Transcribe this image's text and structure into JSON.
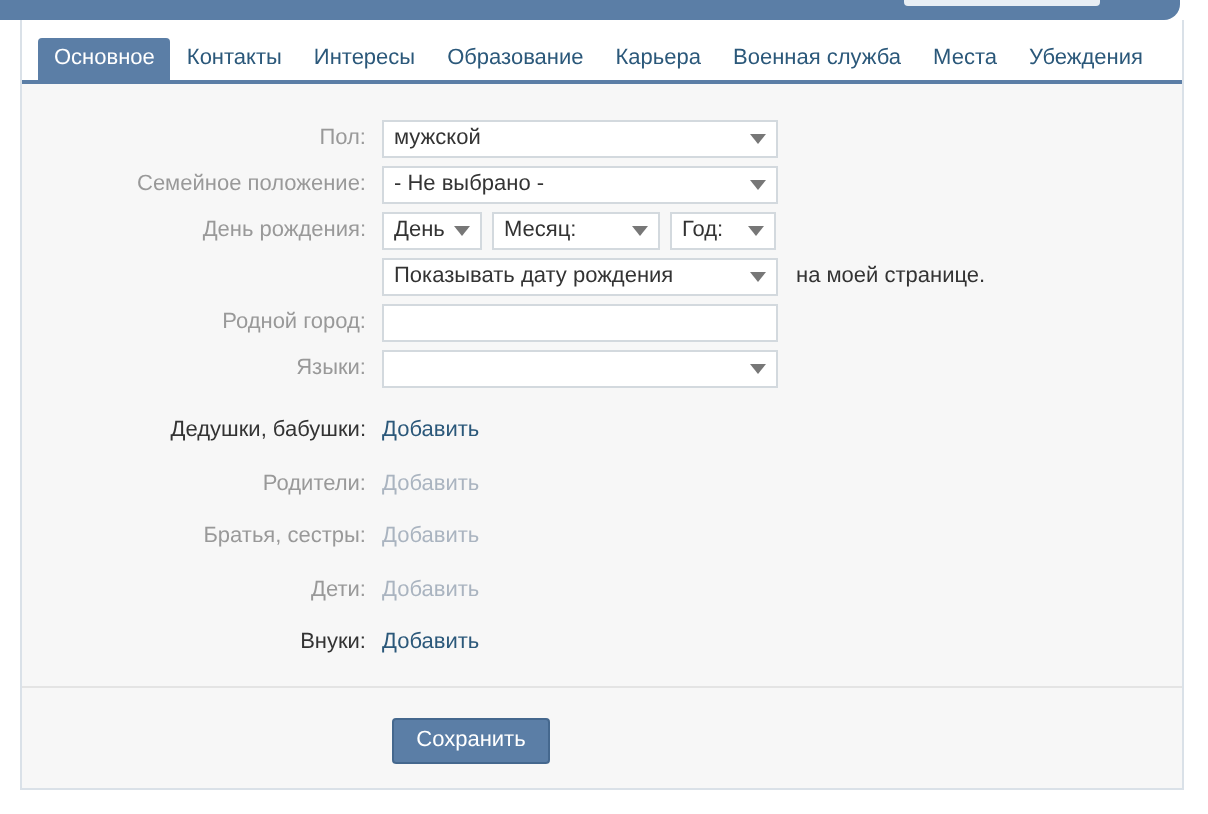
{
  "tabs": [
    {
      "label": "Основное",
      "selected": true
    },
    {
      "label": "Контакты",
      "selected": false
    },
    {
      "label": "Интересы",
      "selected": false
    },
    {
      "label": "Образование",
      "selected": false
    },
    {
      "label": "Карьера",
      "selected": false
    },
    {
      "label": "Военная служба",
      "selected": false
    },
    {
      "label": "Места",
      "selected": false
    },
    {
      "label": "Убеждения",
      "selected": false
    }
  ],
  "fields": [
    {
      "kind": "select",
      "label": "Пол:",
      "value": "мужской"
    },
    {
      "kind": "select",
      "label": "Семейное положение:",
      "value": "- Не выбрано -"
    },
    {
      "kind": "date",
      "label": "День рождения:",
      "parts": [
        "День",
        "Месяц:",
        "Год:"
      ]
    },
    {
      "kind": "visibility",
      "value": "Показывать дату рождения",
      "suffix": "на моей странице."
    },
    {
      "kind": "text",
      "label": "Родной город:"
    },
    {
      "kind": "select",
      "label": "Языки:"
    }
  ],
  "relatives": [
    {
      "label": "Дедушки, бабушки:",
      "action": "Добавить",
      "disabled": false
    },
    {
      "label": "Родители:",
      "action": "Добавить",
      "disabled": true
    },
    {
      "label": "Братья, сестры:",
      "action": "Добавить",
      "disabled": true
    },
    {
      "label": "Дети:",
      "action": "Добавить",
      "disabled": true
    },
    {
      "label": "Внуки:",
      "action": "Добавить",
      "disabled": false
    }
  ],
  "save_button": "Сохранить"
}
